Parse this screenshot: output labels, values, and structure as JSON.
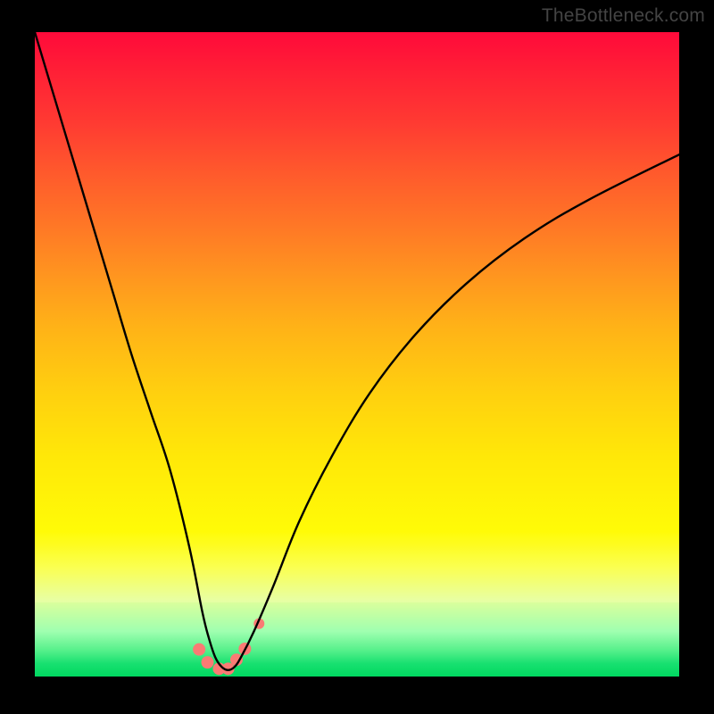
{
  "watermark": "TheBottleneck.com",
  "chart_data": {
    "type": "line",
    "title": "",
    "xlabel": "",
    "ylabel": "",
    "xlim": [
      0,
      100
    ],
    "ylim": [
      0,
      100
    ],
    "grid": false,
    "legend": false,
    "series": [
      {
        "name": "bottleneck-curve",
        "color": "#000000",
        "x": [
          0,
          3,
          6,
          9,
          12,
          15,
          18,
          21,
          24,
          26,
          27,
          28,
          29,
          30,
          31,
          32,
          34,
          37,
          41,
          46,
          52,
          59,
          67,
          76,
          86,
          100
        ],
        "y": [
          100,
          90,
          80,
          70,
          60,
          50,
          41,
          32,
          20,
          10,
          6,
          3,
          1.5,
          1,
          1.5,
          3,
          7,
          14,
          24,
          34,
          44,
          53,
          61,
          68,
          74,
          81
        ]
      }
    ],
    "markers": [
      {
        "x": 25.5,
        "y": 4.2,
        "r": 7,
        "color": "#fa7a74"
      },
      {
        "x": 26.8,
        "y": 2.2,
        "r": 7,
        "color": "#fa7a74"
      },
      {
        "x": 28.6,
        "y": 1.2,
        "r": 7,
        "color": "#fa7a74"
      },
      {
        "x": 30.0,
        "y": 1.2,
        "r": 7,
        "color": "#fa7a74"
      },
      {
        "x": 31.3,
        "y": 2.6,
        "r": 7,
        "color": "#fa7a74"
      },
      {
        "x": 32.6,
        "y": 4.3,
        "r": 7,
        "color": "#fa7a74"
      },
      {
        "x": 34.8,
        "y": 8.2,
        "r": 6,
        "color": "#fa7a74"
      }
    ]
  }
}
